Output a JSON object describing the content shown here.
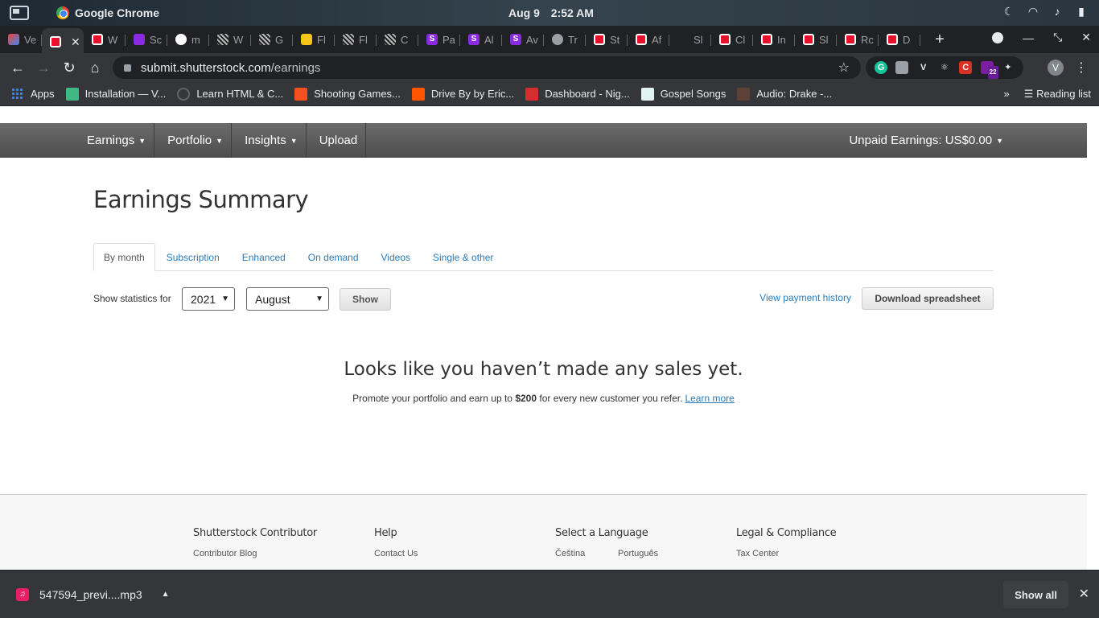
{
  "os": {
    "app_name": "Google Chrome",
    "date": "Aug 9",
    "time": "2:52 AM"
  },
  "tabs": [
    {
      "label": "Ve",
      "favicon": "gmail",
      "active": false
    },
    {
      "label": "",
      "favicon": "shutterstock",
      "active": true
    },
    {
      "label": "W",
      "favicon": "shutterstock",
      "active": false
    },
    {
      "label": "Sc",
      "favicon": "purple-link",
      "active": false
    },
    {
      "label": "m",
      "favicon": "google",
      "active": false
    },
    {
      "label": "W",
      "favicon": "stripe",
      "active": false
    },
    {
      "label": "G",
      "favicon": "stripe",
      "active": false
    },
    {
      "label": "Fl",
      "favicon": "yellow",
      "active": false
    },
    {
      "label": "Fl",
      "favicon": "stripe",
      "active": false
    },
    {
      "label": "C",
      "favicon": "stripe",
      "active": false
    },
    {
      "label": "Pa",
      "favicon": "purple-s",
      "active": false
    },
    {
      "label": "Al",
      "favicon": "purple-s",
      "active": false
    },
    {
      "label": "Av",
      "favicon": "purple-s",
      "active": false
    },
    {
      "label": "Tr",
      "favicon": "globe",
      "active": false
    },
    {
      "label": "St",
      "favicon": "shutterstock",
      "active": false
    },
    {
      "label": "Af",
      "favicon": "shutterstock",
      "active": false
    },
    {
      "label": "Sl",
      "favicon": "blank",
      "active": false
    },
    {
      "label": "Cl",
      "favicon": "shutterstock",
      "active": false
    },
    {
      "label": "In",
      "favicon": "shutterstock",
      "active": false
    },
    {
      "label": "Sl",
      "favicon": "shutterstock",
      "active": false
    },
    {
      "label": "Rc",
      "favicon": "shutterstock",
      "active": false
    },
    {
      "label": "D",
      "favicon": "shutterstock",
      "active": false
    }
  ],
  "address": {
    "host": "submit.shutterstock.com",
    "path": "/earnings"
  },
  "extensions": {
    "badge_count": "22",
    "profile_initial": "V"
  },
  "bookmarks": [
    {
      "label": "Apps",
      "icon": "apps-grid-icon"
    },
    {
      "label": "Installation — V...",
      "icon": "vue-icon"
    },
    {
      "label": "Learn HTML & C...",
      "icon": "loading-icon"
    },
    {
      "label": "Shooting Games...",
      "icon": "game-icon"
    },
    {
      "label": "Drive By by Eric...",
      "icon": "soundcloud-icon"
    },
    {
      "label": "Dashboard - Nig...",
      "icon": "dashboard-icon"
    },
    {
      "label": "Gospel Songs",
      "icon": "music-icon"
    },
    {
      "label": "Audio: Drake -...",
      "icon": "audio-icon"
    }
  ],
  "bookmarks_right": {
    "reading_list": "Reading list"
  },
  "site_nav": {
    "items": [
      "Earnings",
      "Portfolio",
      "Insights",
      "Upload"
    ],
    "unpaid": "Unpaid Earnings: US$0.00"
  },
  "page": {
    "title": "Earnings Summary",
    "tabs": [
      "By month",
      "Subscription",
      "Enhanced",
      "On demand",
      "Videos",
      "Single & other"
    ],
    "stats_label": "Show statistics for",
    "year": "2021",
    "month": "August",
    "show_button": "Show",
    "view_history": "View payment history",
    "download_button": "Download spreadsheet",
    "empty_title": "Looks like you haven’t made any sales yet.",
    "empty_prefix": "Promote your portfolio and earn up to",
    "empty_amount": "$200",
    "empty_suffix": "for every new customer you refer.",
    "learn_more": "Learn more"
  },
  "footer": {
    "col1_title": "Shutterstock Contributor",
    "col1_link": "Contributor Blog",
    "col2_title": "Help",
    "col2_link": "Contact Us",
    "col3_title": "Select a Language",
    "col3_links": [
      "Čeština",
      "Português"
    ],
    "col4_title": "Legal & Compliance",
    "col4_link": "Tax Center"
  },
  "download_shelf": {
    "file_name": "547594_previ....mp3",
    "show_all": "Show all"
  }
}
